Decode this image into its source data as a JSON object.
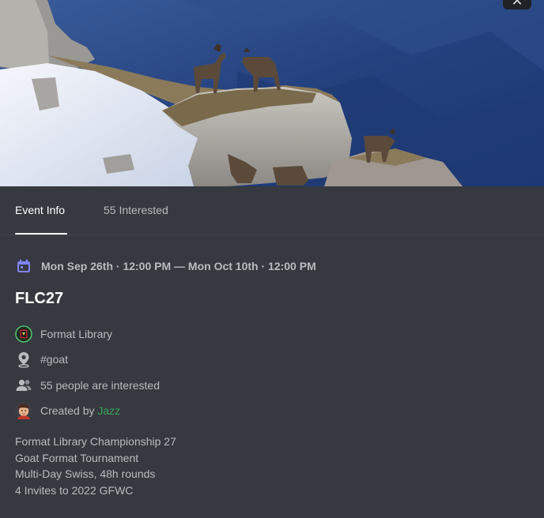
{
  "modal": {
    "close_label": "✕"
  },
  "tabs": [
    {
      "label": "Event Info",
      "active": true
    },
    {
      "label": "55 Interested",
      "active": false
    }
  ],
  "event": {
    "datetime": "Mon Sep 26th · 12:00 PM — Mon Oct 10th · 12:00 PM",
    "title": "FLC27",
    "server": "Format Library",
    "channel": "#goat",
    "interested": "55 people are interested",
    "created_by_prefix": "Created by ",
    "creator": "Jazz",
    "description": [
      "Format Library Championship 27",
      "Goat Format Tournament",
      "Multi-Day Swiss, 48h rounds",
      "4 Invites to 2022 GFWC"
    ]
  },
  "icons": {
    "calendar": "calendar-icon",
    "server": "server-icon",
    "location": "location-pin-icon",
    "people": "people-icon",
    "avatar": "creator-avatar"
  },
  "colors": {
    "background": "#36393f",
    "accent_calendar": "#7f84ff",
    "creator_green": "#3ba55c",
    "muted_text": "#b9bbbe",
    "title_text": "#ffffff"
  }
}
